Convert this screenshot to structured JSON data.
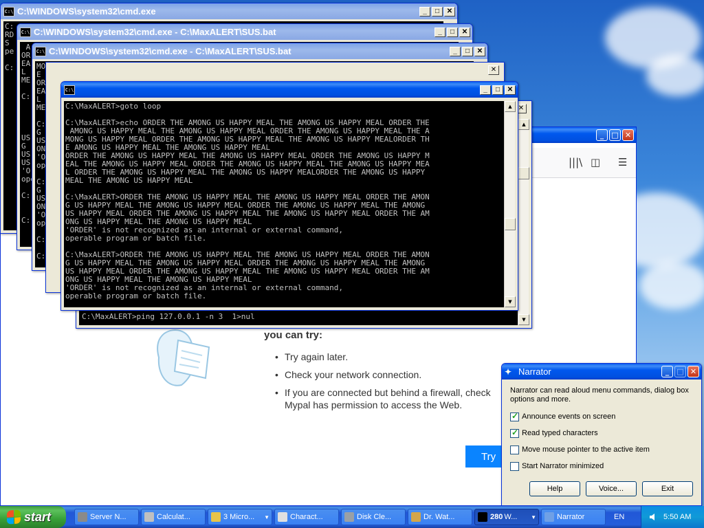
{
  "windows": {
    "cmd1": {
      "title": "C:\\WINDOWS\\system32\\cmd.exe",
      "lines": [
        "C:",
        "RD",
        "S",
        "pe",
        "",
        "C:",
        "",
        "",
        "",
        "",
        "",
        ""
      ]
    },
    "cmd2": {
      "title": "C:\\WINDOWS\\system32\\cmd.exe - C:\\MaxALERT\\SUS.bat",
      "lines": [
        " A",
        "OR",
        "EA",
        "L",
        "ME",
        "",
        "C:",
        "",
        "",
        "",
        "",
        "US",
        "G",
        "US",
        "US",
        "'O",
        "ope",
        "",
        "C:",
        "",
        "",
        "C:"
      ]
    },
    "cmd3": {
      "title": "C:\\WINDOWS\\system32\\cmd.exe - C:\\MaxALERT\\SUS.bat",
      "lines": [
        "MONG US HAPPY MEAL ORDER THE AMONG US HAPPY MEAL THE AMONG US HAPPY MEALORDER TH",
        "E AMONG US HAPPY MEAL THE AMONG US HAPPY MEAL",
        "ORDER",
        "EA",
        "L",
        "MEAL",
        "",
        "C:",
        "G",
        "US",
        "ONG",
        "'OR",
        "opera",
        "",
        "C:",
        "G",
        "US",
        "ONG",
        "'ORD",
        "opera",
        "",
        "C:",
        "",
        "C:"
      ]
    },
    "cmd4": {
      "title": "",
      "lines": [
        "C:\\MaxALERT>goto loop",
        "",
        "C:\\MaxALERT>echo ORDER THE AMONG US HAPPY MEAL THE AMONG US HAPPY MEAL ORDER THE",
        " AMONG US HAPPY MEAL THE AMONG US HAPPY MEAL ORDER THE AMONG US HAPPY MEAL THE A",
        "MONG US HAPPY MEAL ORDER THE AMONG US HAPPY MEAL THE AMONG US HAPPY MEALORDER TH",
        "E AMONG US HAPPY MEAL THE AMONG US HAPPY MEAL",
        "ORDER THE AMONG US HAPPY MEAL THE AMONG US HAPPY MEAL ORDER THE AMONG US HAPPY M",
        "EAL THE AMONG US HAPPY MEAL ORDER THE AMONG US HAPPY MEAL THE AMONG US HAPPY MEA",
        "L ORDER THE AMONG US HAPPY MEAL THE AMONG US HAPPY MEALORDER THE AMONG US HAPPY ",
        "MEAL THE AMONG US HAPPY MEAL",
        "",
        "C:\\MaxALERT>ORDER THE AMONG US HAPPY MEAL THE AMONG US HAPPY MEAL ORDER THE AMON",
        "G US HAPPY MEAL THE AMONG US HAPPY MEAL ORDER THE AMONG US HAPPY MEAL THE AMONG ",
        "US HAPPY MEAL ORDER THE AMONG US HAPPY MEAL THE AMONG US HAPPY MEAL ORDER THE AM",
        "ONG US HAPPY MEAL THE AMONG US HAPPY MEAL",
        "'ORDER' is not recognized as an internal or external command,",
        "operable program or batch file.",
        "",
        "C:\\MaxALERT>ORDER THE AMONG US HAPPY MEAL THE AMONG US HAPPY MEAL ORDER THE AMON",
        "G US HAPPY MEAL THE AMONG US HAPPY MEAL ORDER THE AMONG US HAPPY MEAL THE AMONG ",
        "US HAPPY MEAL ORDER THE AMONG US HAPPY MEAL THE AMONG US HAPPY MEAL ORDER THE AM",
        "ONG US HAPPY MEAL THE AMONG US HAPPY MEAL",
        "'ORDER' is not recognized as an internal or external command,",
        "operable program or batch file."
      ]
    },
    "cmd5": {
      "lines": [
        "C:\\MaxALERT>ping 127.0.0.1 -n 3  1>nul"
      ]
    }
  },
  "browser": {
    "error": {
      "heading": "you can try:",
      "items": [
        "Try again later.",
        "Check your network connection.",
        "If you are connected but behind a firewall, check",
        "Mypal has permission to access the Web."
      ],
      "try_button": "Try"
    }
  },
  "narrator": {
    "title": "Narrator",
    "description": "Narrator can read aloud menu commands, dialog box options and more.",
    "options": [
      {
        "label": "Announce events on screen",
        "checked": true
      },
      {
        "label": "Read typed characters",
        "checked": true
      },
      {
        "label": "Move mouse pointer to the active item",
        "checked": false
      },
      {
        "label": "Start Narrator minimized",
        "checked": false
      }
    ],
    "buttons": {
      "help": "Help",
      "voice": "Voice...",
      "exit": "Exit"
    }
  },
  "taskbar": {
    "start": "start",
    "tasks": [
      {
        "label": "Server N...",
        "icon_color": "#8a8a8a"
      },
      {
        "label": "Calculat...",
        "icon_color": "#c0c0c0"
      },
      {
        "label": "3 Micro...",
        "icon_color": "#e8c44a",
        "dropdown": true
      },
      {
        "label": "Charact...",
        "icon_color": "#e0e0e0"
      },
      {
        "label": "Disk Cle...",
        "icon_color": "#9aa0a6"
      },
      {
        "label": "Dr. Wat...",
        "icon_color": "#d4a64a"
      },
      {
        "count": "280",
        "label": "W...",
        "icon_color": "#000000",
        "dropdown": true,
        "active": true
      },
      {
        "label": "Narrator",
        "icon_color": "#6fa0e6"
      }
    ],
    "language": "EN",
    "clock": "5:50 AM"
  },
  "colors": {
    "xp_blue": "#0054e3",
    "console_bg": "#000000",
    "console_fg": "#c0c0c0",
    "firefox_blue": "#0a84ff"
  }
}
